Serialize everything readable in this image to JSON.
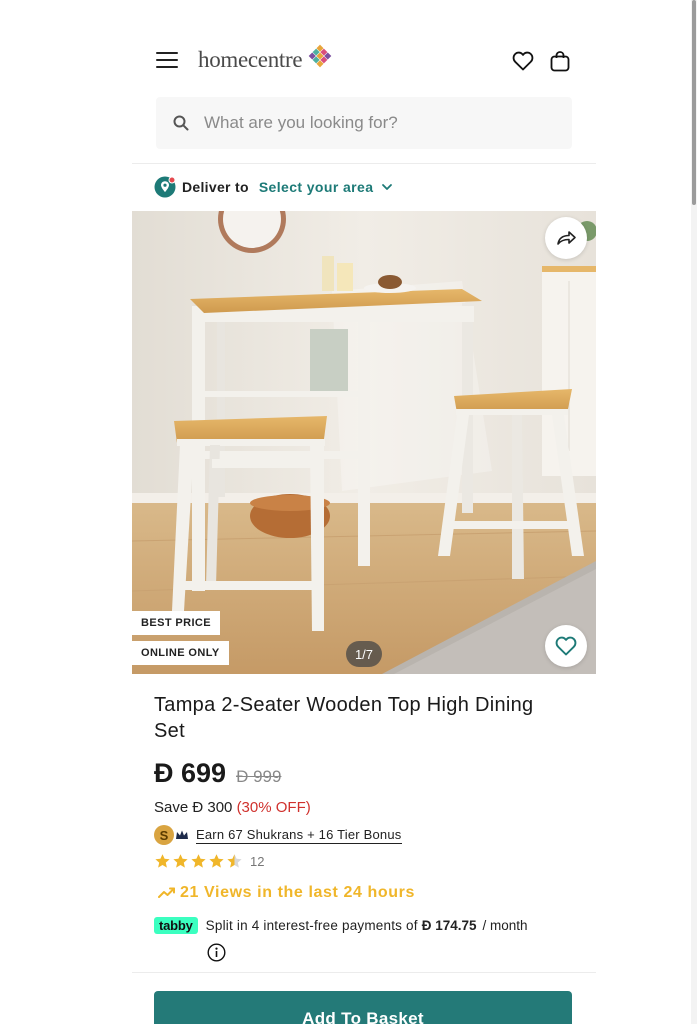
{
  "header": {
    "logo_text": "homecentre",
    "icons": [
      "hamburger-menu-icon",
      "heart-icon",
      "shopping-bag-icon"
    ]
  },
  "search": {
    "placeholder": "What are you looking for?"
  },
  "delivery": {
    "label": "Deliver to",
    "area": "Select your area"
  },
  "gallery": {
    "badges": [
      "BEST PRICE",
      "ONLINE ONLY"
    ],
    "counter": "1/7",
    "current": 1,
    "total": 7
  },
  "product": {
    "title": "Tampa 2-Seater Wooden Top High Dining Set",
    "price": "Đ 699",
    "old_price": "Đ 999",
    "save_label": "Save Đ 300",
    "discount": "(30% OFF)",
    "shukrans": "Earn 67 Shukrans + 16  Tier Bonus",
    "shukran_coin": "S",
    "rating": 4.5,
    "rating_count": "12",
    "views": "21 Views in the last 24 hours"
  },
  "tabby": {
    "logo": "tabby",
    "text": "Split in 4 interest-free payments of",
    "amount": "Đ 174.75",
    "period": "/ month"
  },
  "actions": {
    "add_to_basket": "Add To Basket"
  },
  "colors": {
    "accent": "#247a78",
    "link": "#1d7a77",
    "discount": "#d0312d",
    "views": "#f0b62a",
    "tabby": "#3bffc0"
  }
}
